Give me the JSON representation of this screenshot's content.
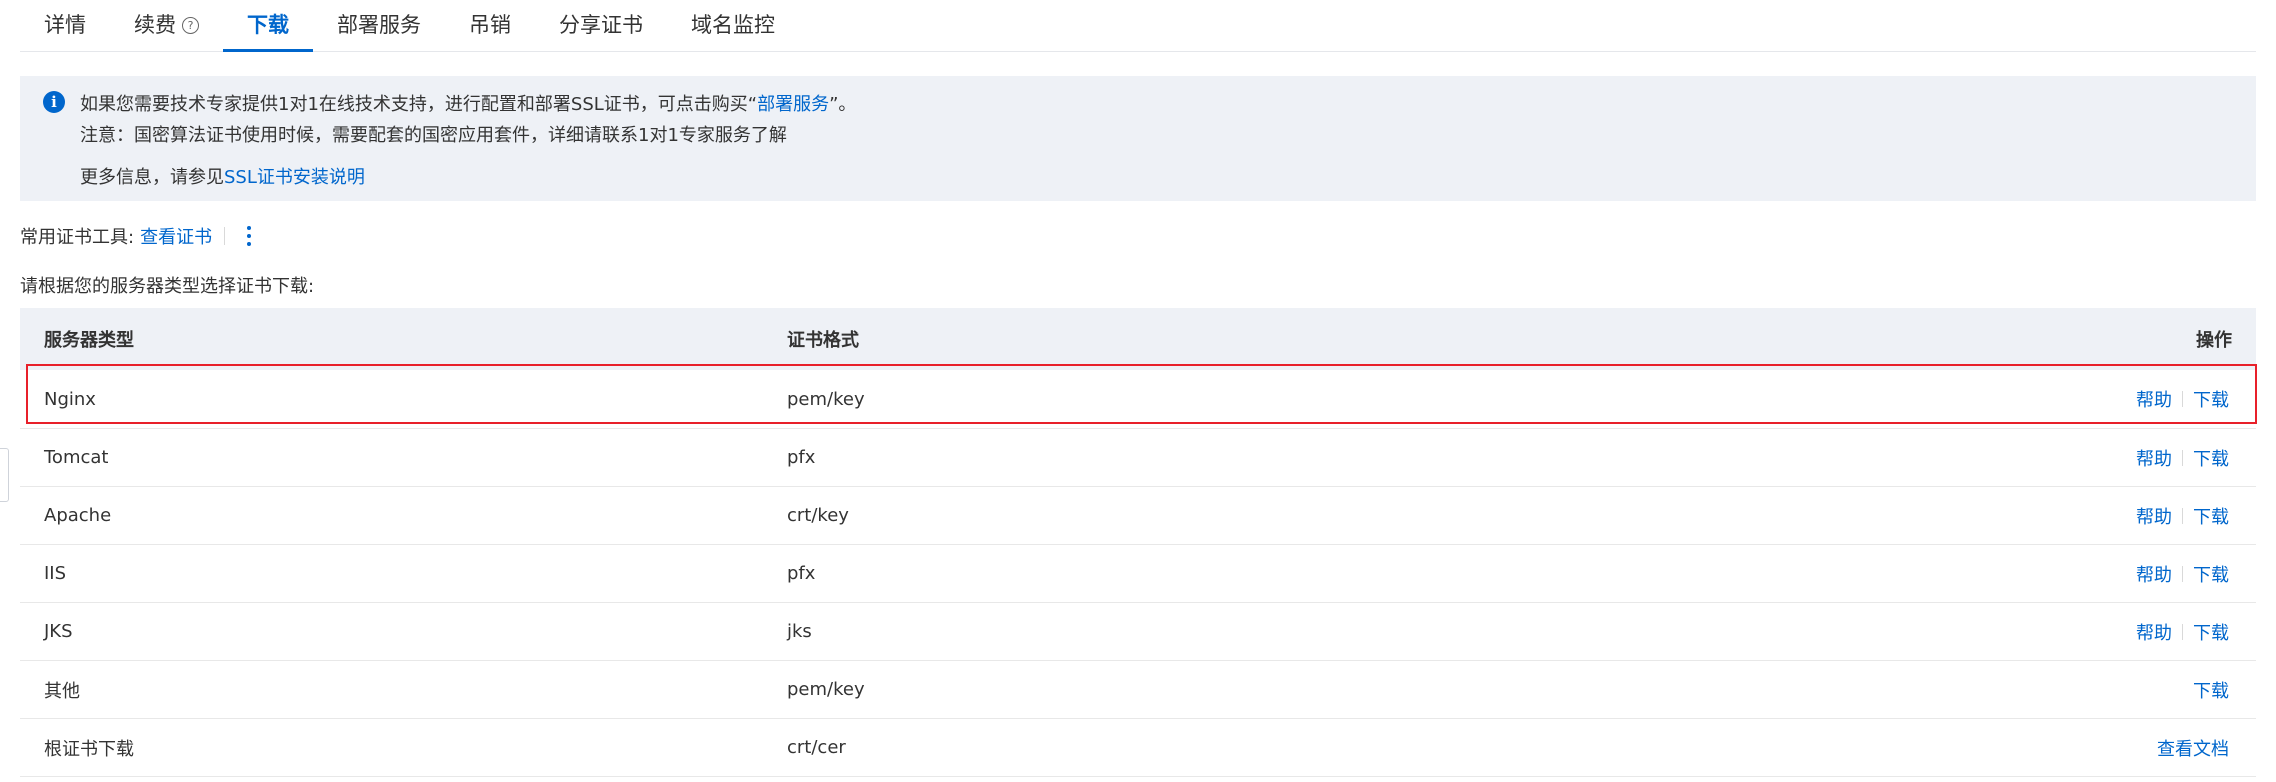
{
  "tabs": [
    {
      "label": "详情",
      "active": false
    },
    {
      "label": "续费",
      "active": false,
      "has_help_icon": true
    },
    {
      "label": "下载",
      "active": true
    },
    {
      "label": "部署服务",
      "active": false
    },
    {
      "label": "吊销",
      "active": false
    },
    {
      "label": "分享证书",
      "active": false
    },
    {
      "label": "域名监控",
      "active": false
    }
  ],
  "help_icon_glyph": "?",
  "info": {
    "icon": "info-icon",
    "icon_glyph": "i",
    "line1_prefix": "如果您需要技术专家提供1对1在线技术支持，进行配置和部署SSL证书，可点击购买“",
    "line1_link": "部署服务",
    "line1_suffix": "”。",
    "line2": "注意：国密算法证书使用时候，需要配套的国密应用套件，详细请联系1对1专家服务了解",
    "line3_prefix": "更多信息，请参见",
    "line3_link": "SSL证书安装说明"
  },
  "tools": {
    "label": "常用证书工具:",
    "link": "查看证书",
    "more_icon": "more-vertical-icon"
  },
  "prompt": "请根据您的服务器类型选择证书下载:",
  "table": {
    "headers": {
      "server_type": "服务器类型",
      "format": "证书格式",
      "action": "操作"
    },
    "rows": [
      {
        "server_type": "Nginx",
        "format": "pem/key",
        "help": "帮助",
        "download": "下载"
      },
      {
        "server_type": "Tomcat",
        "format": "pfx",
        "help": "帮助",
        "download": "下载"
      },
      {
        "server_type": "Apache",
        "format": "crt/key",
        "help": "帮助",
        "download": "下载"
      },
      {
        "server_type": "IIS",
        "format": "pfx",
        "help": "帮助",
        "download": "下载"
      },
      {
        "server_type": "JKS",
        "format": "jks",
        "help": "帮助",
        "download": "下载"
      },
      {
        "server_type": "其他",
        "format": "pem/key",
        "download": "下载"
      },
      {
        "server_type": "根证书下载",
        "format": "crt/cer",
        "view_doc": "查看文档"
      }
    ]
  },
  "colors": {
    "accent": "#0066cc",
    "highlight_border": "#e8202a",
    "panel_bg": "#eef1f6"
  }
}
